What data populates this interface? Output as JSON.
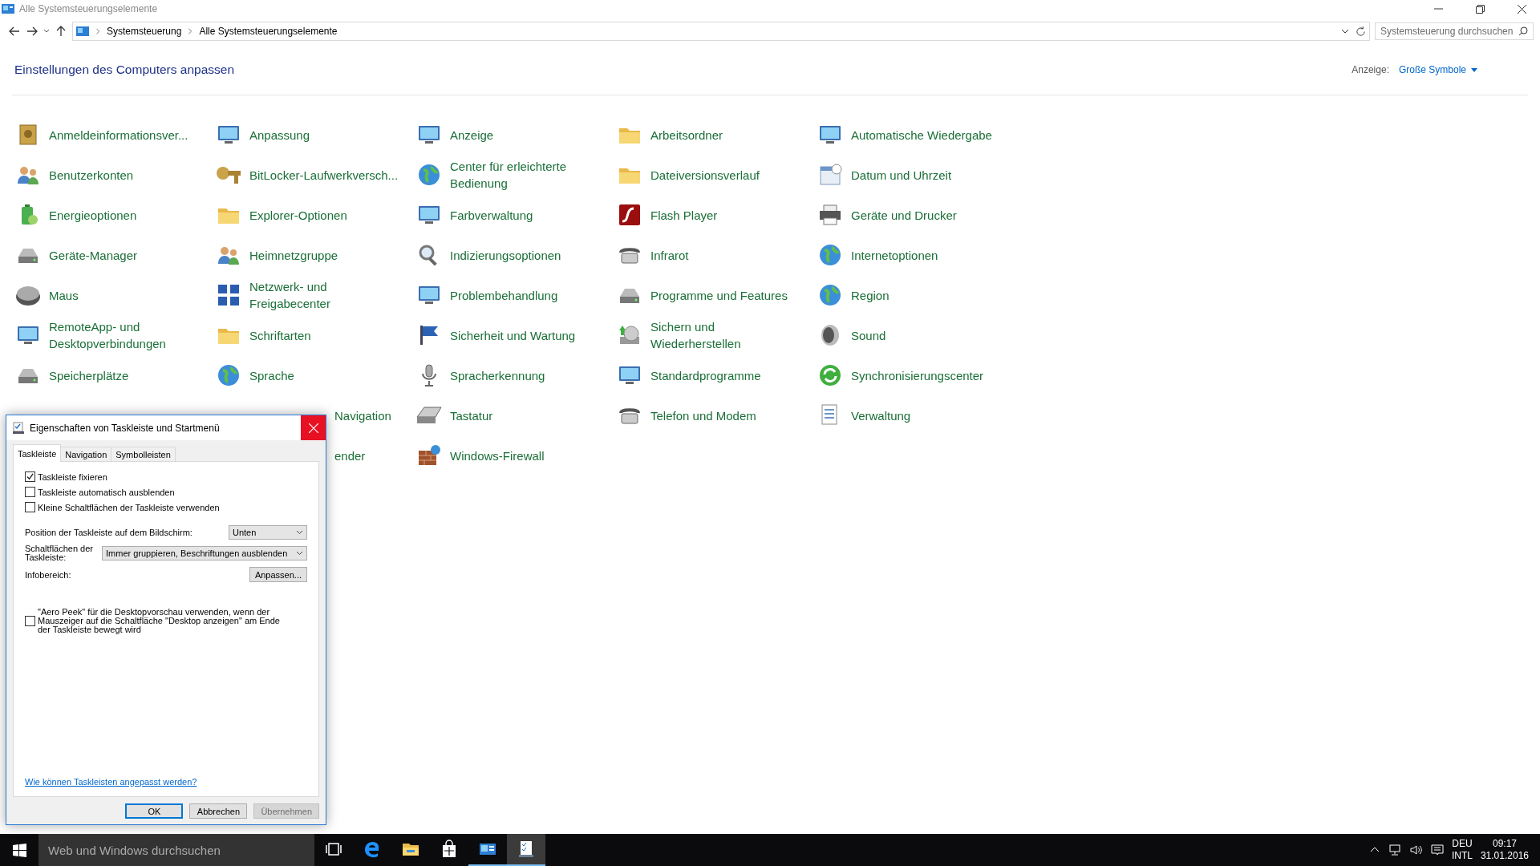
{
  "window": {
    "title": "Alle Systemsteuerungselemente"
  },
  "address_bar": {
    "breadcrumbs": [
      "Systemsteuerung",
      "Alle Systemsteuerungselemente"
    ],
    "search": {
      "placeholder": "Systemsteuerung durchsuchen"
    }
  },
  "header": {
    "title": "Einstellungen des Computers anpassen",
    "view_label": "Anzeige:",
    "view_value": "Große Symbole"
  },
  "items": [
    {
      "label": "Anmeldeinformationsver...",
      "kind": "item"
    },
    {
      "label": "Anpassung",
      "kind": "item"
    },
    {
      "label": "Anzeige",
      "kind": "item"
    },
    {
      "label": "Arbeitsordner",
      "kind": "item"
    },
    {
      "label": "Automatische Wiedergabe",
      "kind": "item"
    },
    {
      "label": "Benutzerkonten",
      "kind": "item"
    },
    {
      "label": "BitLocker-Laufwerkversch...",
      "kind": "item"
    },
    {
      "label": "Center für erleichterte Bedienung",
      "kind": "item"
    },
    {
      "label": "Dateiversionsverlauf",
      "kind": "item"
    },
    {
      "label": "Datum und Uhrzeit",
      "kind": "item"
    },
    {
      "label": "Energieoptionen",
      "kind": "item"
    },
    {
      "label": "Explorer-Optionen",
      "kind": "item"
    },
    {
      "label": "Farbverwaltung",
      "kind": "item"
    },
    {
      "label": "Flash Player",
      "kind": "item"
    },
    {
      "label": "Geräte und Drucker",
      "kind": "item"
    },
    {
      "label": "Geräte-Manager",
      "kind": "item"
    },
    {
      "label": "Heimnetzgruppe",
      "kind": "item"
    },
    {
      "label": "Indizierungsoptionen",
      "kind": "item"
    },
    {
      "label": "Infrarot",
      "kind": "item"
    },
    {
      "label": "Internetoptionen",
      "kind": "item"
    },
    {
      "label": "Maus",
      "kind": "item"
    },
    {
      "label": "Netzwerk- und Freigabecenter",
      "kind": "item"
    },
    {
      "label": "Problembehandlung",
      "kind": "item"
    },
    {
      "label": "Programme und Features",
      "kind": "item"
    },
    {
      "label": "Region",
      "kind": "item"
    },
    {
      "label": "RemoteApp- und Desktopverbindungen",
      "kind": "item"
    },
    {
      "label": "Schriftarten",
      "kind": "item"
    },
    {
      "label": "Sicherheit und Wartung",
      "kind": "item"
    },
    {
      "label": "Sichern und Wiederherstellen",
      "kind": "item"
    },
    {
      "label": "Sound",
      "kind": "item"
    },
    {
      "label": "Speicherplätze",
      "kind": "item"
    },
    {
      "label": "Sprache",
      "kind": "item"
    },
    {
      "label": "Spracherkennung",
      "kind": "item"
    },
    {
      "label": "Standardprogramme",
      "kind": "item"
    },
    {
      "label": "Synchronisierungscenter",
      "kind": "item"
    },
    {
      "label": "Navigation",
      "kind": "partial"
    },
    {
      "label": "Tastatur",
      "kind": "item"
    },
    {
      "label": "Telefon und Modem",
      "kind": "item"
    },
    {
      "label": "Verwaltung",
      "kind": "item"
    },
    {
      "label": "ender",
      "kind": "partial"
    },
    {
      "label": "Windows-Firewall",
      "kind": "item"
    }
  ],
  "dialog": {
    "title": "Eigenschaften von Taskleiste und Startmenü",
    "tabs": [
      {
        "label": "Taskleiste",
        "selected": true
      },
      {
        "label": "Navigation",
        "selected": false
      },
      {
        "label": "Symbolleisten",
        "selected": false
      }
    ],
    "checkboxes": [
      {
        "label": "Taskleiste fixieren",
        "checked": true
      },
      {
        "label": "Taskleiste automatisch ausblenden",
        "checked": false
      },
      {
        "label": "Kleine Schaltflächen der Taskleiste verwenden",
        "checked": false
      }
    ],
    "position": {
      "label": "Position der Taskleiste auf dem Bildschirm:",
      "value": "Unten"
    },
    "grouping": {
      "label": "Schaltflächen der Taskleiste:",
      "value": "Immer gruppieren, Beschriftungen ausblenden"
    },
    "notification_area": {
      "label": "Infobereich:",
      "button": "Anpassen..."
    },
    "aero_peek": {
      "label": "\"Aero Peek\" für die Desktopvorschau verwenden, wenn der Mauszeiger auf die Schaltfläche \"Desktop anzeigen\" am Ende der Taskleiste bewegt wird",
      "checked": false
    },
    "help_link": "Wie können Taskleisten angepasst werden?",
    "buttons": [
      {
        "label": "OK",
        "default": true,
        "disabled": false
      },
      {
        "label": "Abbrechen",
        "default": false,
        "disabled": false
      },
      {
        "label": "Übernehmen",
        "default": false,
        "disabled": true
      }
    ]
  },
  "taskbar": {
    "search": {
      "placeholder": "Web und Windows durchsuchen"
    },
    "apps": [
      {
        "kind": "task-view",
        "running": false,
        "selected": false
      },
      {
        "kind": "browser",
        "running": false,
        "selected": false
      },
      {
        "kind": "explorer",
        "running": false,
        "selected": false
      },
      {
        "kind": "store",
        "running": false,
        "selected": false
      },
      {
        "kind": "control-panel",
        "running": true,
        "selected": false
      },
      {
        "kind": "taskbar-settings",
        "running": true,
        "selected": true
      }
    ],
    "tray": {
      "language": "DEU",
      "layout": "INTL",
      "time": "09:17",
      "date": "31.01.2016"
    }
  }
}
